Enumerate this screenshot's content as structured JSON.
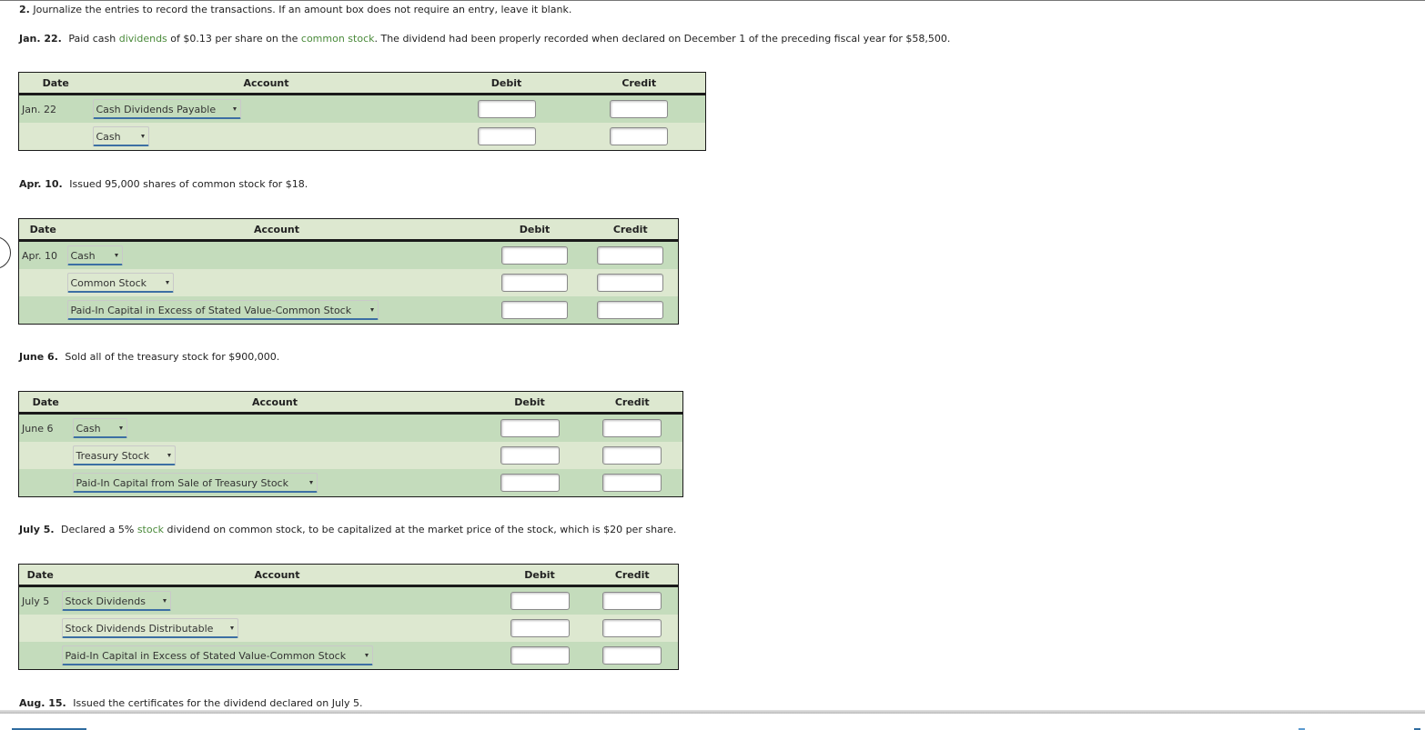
{
  "instruction": {
    "number": "2.",
    "text": "Journalize the entries to record the transactions. If an amount box does not require an entry, leave it blank."
  },
  "table_headers": {
    "date": "Date",
    "account": "Account",
    "debit": "Debit",
    "credit": "Credit"
  },
  "transactions": [
    {
      "date_label": "Jan. 22.",
      "description_parts": [
        {
          "text": "Paid cash ",
          "link": false
        },
        {
          "text": "dividends",
          "link": true
        },
        {
          "text": " of $0.13 per share on the ",
          "link": false
        },
        {
          "text": "common stock",
          "link": true
        },
        {
          "text": ". The dividend had been properly recorded when declared on December 1 of the preceding fiscal year for $58,500.",
          "link": false
        }
      ],
      "rows": [
        {
          "date": "Jan. 22",
          "account": "Cash Dividends Payable",
          "debit": "",
          "credit": ""
        },
        {
          "date": "",
          "account": "Cash",
          "debit": "",
          "credit": ""
        }
      ]
    },
    {
      "date_label": "Apr. 10.",
      "description_parts": [
        {
          "text": "Issued 95,000 shares of common stock for $18.",
          "link": false
        }
      ],
      "rows": [
        {
          "date": "Apr. 10",
          "account": "Cash",
          "debit": "",
          "credit": ""
        },
        {
          "date": "",
          "account": "Common Stock",
          "debit": "",
          "credit": ""
        },
        {
          "date": "",
          "account": "Paid-In Capital in Excess of Stated Value-Common Stock",
          "debit": "",
          "credit": ""
        }
      ]
    },
    {
      "date_label": "June 6.",
      "description_parts": [
        {
          "text": "Sold all of the treasury stock for $900,000.",
          "link": false
        }
      ],
      "rows": [
        {
          "date": "June 6",
          "account": "Cash",
          "debit": "",
          "credit": ""
        },
        {
          "date": "",
          "account": "Treasury Stock",
          "debit": "",
          "credit": ""
        },
        {
          "date": "",
          "account": "Paid-In Capital from Sale of Treasury Stock",
          "debit": "",
          "credit": ""
        }
      ]
    },
    {
      "date_label": "July 5.",
      "description_parts": [
        {
          "text": "Declared a 5% ",
          "link": false
        },
        {
          "text": "stock",
          "link": true
        },
        {
          "text": " dividend on common stock, to be capitalized at the market price of the stock, which is $20 per share.",
          "link": false
        }
      ],
      "rows": [
        {
          "date": "July 5",
          "account": "Stock Dividends",
          "debit": "",
          "credit": ""
        },
        {
          "date": "",
          "account": "Stock Dividends Distributable",
          "debit": "",
          "credit": ""
        },
        {
          "date": "",
          "account": "Paid-In Capital in Excess of Stated Value-Common Stock",
          "debit": "",
          "credit": ""
        }
      ]
    },
    {
      "date_label": "Aug. 15.",
      "description_parts": [
        {
          "text": "Issued the certificates for the dividend declared on July 5.",
          "link": false
        }
      ],
      "rows": []
    }
  ],
  "colors": {
    "link_green": "#4a8a3a",
    "row_dark": "#c4dcbc",
    "row_light": "#dde8d0",
    "select_underline": "#3c6fa3"
  }
}
